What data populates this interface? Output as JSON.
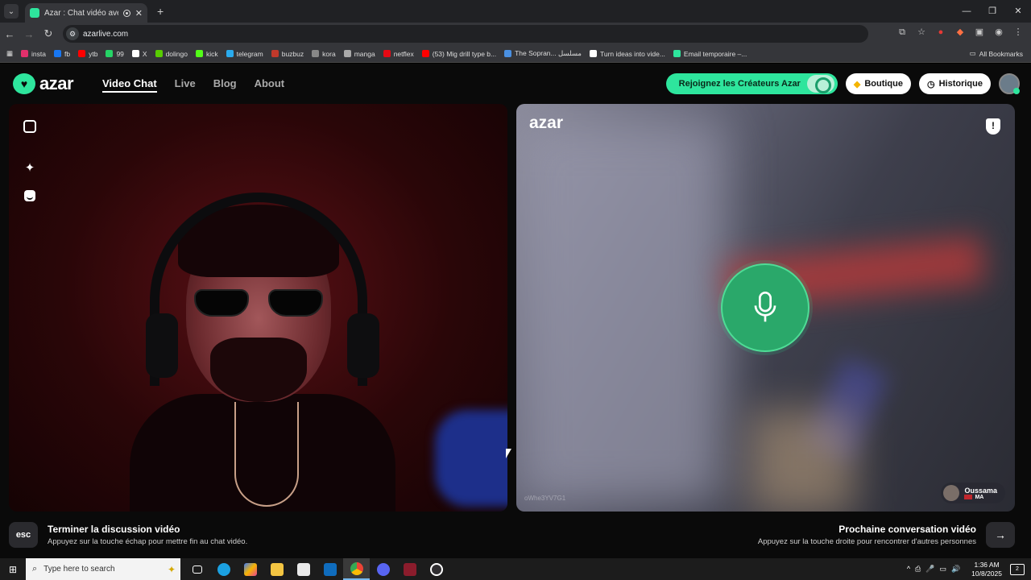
{
  "browser": {
    "tab_title": "Azar : Chat vidéo avec de n",
    "url": "azarlive.com",
    "bookmarks": [
      {
        "label": "insta",
        "color": "#e1306c"
      },
      {
        "label": "fb",
        "color": "#1877f2"
      },
      {
        "label": "ytb",
        "color": "#ff0000"
      },
      {
        "label": "99",
        "color": "#25d366"
      },
      {
        "label": "X",
        "color": "#ffffff"
      },
      {
        "label": "dolingo",
        "color": "#58cc02"
      },
      {
        "label": "kick",
        "color": "#53fc18"
      },
      {
        "label": "telegram",
        "color": "#2aabee"
      },
      {
        "label": "buzbuz",
        "color": "#c0392b"
      },
      {
        "label": "kora",
        "color": "#888888"
      },
      {
        "label": "manga",
        "color": "#aaaaaa"
      },
      {
        "label": "netflex",
        "color": "#e50914"
      },
      {
        "label": "(53) Mig drill type b...",
        "color": "#ff0000"
      },
      {
        "label": "The Sopran... مسلسل",
        "color": "#4a90e2"
      },
      {
        "label": "Turn ideas into vide...",
        "color": "#ffffff"
      },
      {
        "label": "Email temporaire –...",
        "color": "#2ee59d"
      }
    ],
    "all_bookmarks": "All Bookmarks"
  },
  "header": {
    "logo": "azar",
    "nav": [
      "Video Chat",
      "Live",
      "Blog",
      "About"
    ],
    "creators_label": "Rejoignez les Créateurs Azar",
    "boutique_label": "Boutique",
    "historique_label": "Historique"
  },
  "remote": {
    "watermark": "azar",
    "user_id": "oWhe3YV7G1",
    "partner_name": "Oussama",
    "partner_country": "MA"
  },
  "footer": {
    "esc_key": "esc",
    "end_title": "Terminer la discussion vidéo",
    "end_sub": "Appuyez sur la touche échap pour mettre fin au chat vidéo.",
    "next_title": "Prochaine conversation vidéo",
    "next_sub": "Appuyez sur la touche droite pour rencontrer d'autres personnes",
    "next_key": "→"
  },
  "taskbar": {
    "search_placeholder": "Type here to search",
    "time": "1:36 AM",
    "date": "10/8/2025",
    "notifications": "2"
  },
  "colors": {
    "accent": "#2ee59d",
    "mic": "#2aa86a"
  }
}
